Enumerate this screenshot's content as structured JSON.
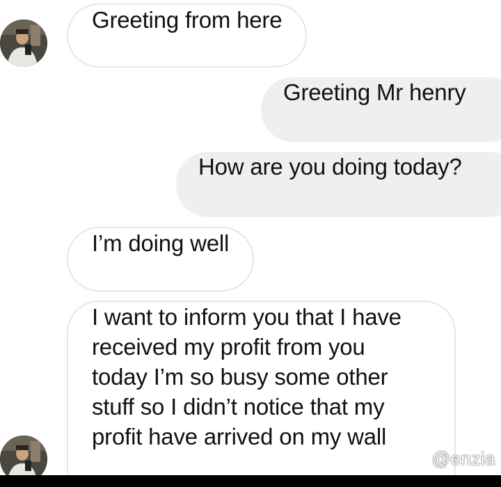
{
  "messages": [
    {
      "direction": "incoming",
      "text": "Greeting from here"
    },
    {
      "direction": "outgoing",
      "text": "Greeting Mr henry"
    },
    {
      "direction": "outgoing",
      "text": "How are you doing today?"
    },
    {
      "direction": "incoming",
      "text": "I’m doing well"
    },
    {
      "direction": "incoming",
      "lines": [
        "I want to inform you that I have",
        "received my profit from you",
        "today I’m so busy some other",
        "stuff so I didn’t notice that my",
        "profit have arrived on my wall"
      ]
    }
  ],
  "watermark": "@enzia",
  "colors": {
    "incoming_bubble": "#ffffff",
    "incoming_border": "#e6e6e6",
    "outgoing_bubble": "#efefef",
    "text": "#111111"
  },
  "icons": {
    "avatar": "profile-photo"
  }
}
